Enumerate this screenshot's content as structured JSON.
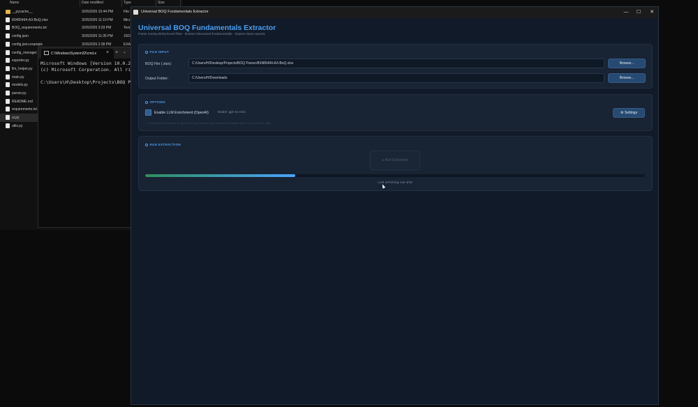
{
  "explorer": {
    "headers": {
      "name": "Name",
      "date": "Date modified",
      "type": "Type",
      "size": "Size"
    },
    "rows": [
      {
        "name": "__pycache__",
        "date": "3/26/2026 10:44 PM",
        "type": "File f",
        "icon": "folder-icon"
      },
      {
        "name": "83485494-A3-BoQ.xlsx",
        "date": "3/26/2026 11:10 PM",
        "type": "Micr",
        "icon": "file-icon"
      },
      {
        "name": "BOQ_requirements.txt",
        "date": "3/26/2026 3:29 PM",
        "type": "Text",
        "icon": "file-icon"
      },
      {
        "name": "config.json",
        "date": "3/26/2026 11:35 PM",
        "type": "JSON",
        "icon": "file-icon"
      },
      {
        "name": "config.json.example",
        "date": "3/26/2026 2:38 PM",
        "type": "EXAI",
        "icon": "file-icon"
      },
      {
        "name": "config_manager",
        "date": "",
        "type": "",
        "icon": "file-icon"
      },
      {
        "name": "exporter.py",
        "date": "",
        "type": "",
        "icon": "file-icon"
      },
      {
        "name": "llm_helper.py",
        "date": "",
        "type": "",
        "icon": "file-icon"
      },
      {
        "name": "main.py",
        "date": "",
        "type": "",
        "icon": "file-icon"
      },
      {
        "name": "models.py",
        "date": "",
        "type": "",
        "icon": "file-icon"
      },
      {
        "name": "parser.py",
        "date": "",
        "type": "",
        "icon": "file-icon"
      },
      {
        "name": "README.md",
        "date": "",
        "type": "",
        "icon": "file-icon"
      },
      {
        "name": "requirements.txt",
        "date": "",
        "type": "",
        "icon": "file-icon"
      },
      {
        "name": "ui.py",
        "date": "",
        "type": "",
        "icon": "file-icon",
        "selected": true
      },
      {
        "name": "utils.py",
        "date": "",
        "type": "",
        "icon": "file-icon"
      }
    ]
  },
  "terminal": {
    "tab_title": "C:\\Windows\\System32\\cmd.e",
    "close_glyph": "×",
    "new_tab_glyph": "+",
    "dropdown_glyph": "⌄",
    "lines": [
      "Microsoft Windows [Version 10.0.262",
      "(c) Microsoft Corporation. All righ",
      "",
      "C:\\Users\\H\\Desktop\\Projects\\BOQ Par"
    ]
  },
  "app": {
    "window_title": "Universal BOQ Fundamentals Extractor",
    "minimize_glyph": "—",
    "maximize_glyph": "☐",
    "close_glyph": "✕",
    "title": "Universal BOQ Fundamentals Extractor",
    "subtitle": "Parse messy BOQ Excel files · Extract structured fundamentals · Export clean reports",
    "file_input": {
      "section_title": "FILE INPUT",
      "boq_label": "BOQ File (.xlsx):",
      "boq_value": "C:/Users/H/Desktop/Projects/BOQ Parser/83485494-A3-BoQ.xlsx",
      "output_label": "Output Folder:",
      "output_value": "C:/Users/H/Downloads",
      "browse_label": "Browse..."
    },
    "options": {
      "section_title": "OPTIONS",
      "llm_label": "Enable LLM Enrichment (OpenAI)",
      "llm_checked": true,
      "model_label": "Model: gpt-4o-mini",
      "settings_label": "⚙ Settings",
      "hint": "ⓘ LLM enrichment requires an OpenAI API key. Without a key, rule-based extraction will be used (no cloud calls)."
    },
    "run": {
      "section_title": "RUN EXTRACTION",
      "button_label": "▸  Run Extraction",
      "progress": 0.3,
      "status": "LLM enriching row 4/10"
    },
    "colors": {
      "accent": "#4d9ef0",
      "progress_start": "#2f8f5e",
      "progress_end": "#4aa3ff"
    }
  }
}
